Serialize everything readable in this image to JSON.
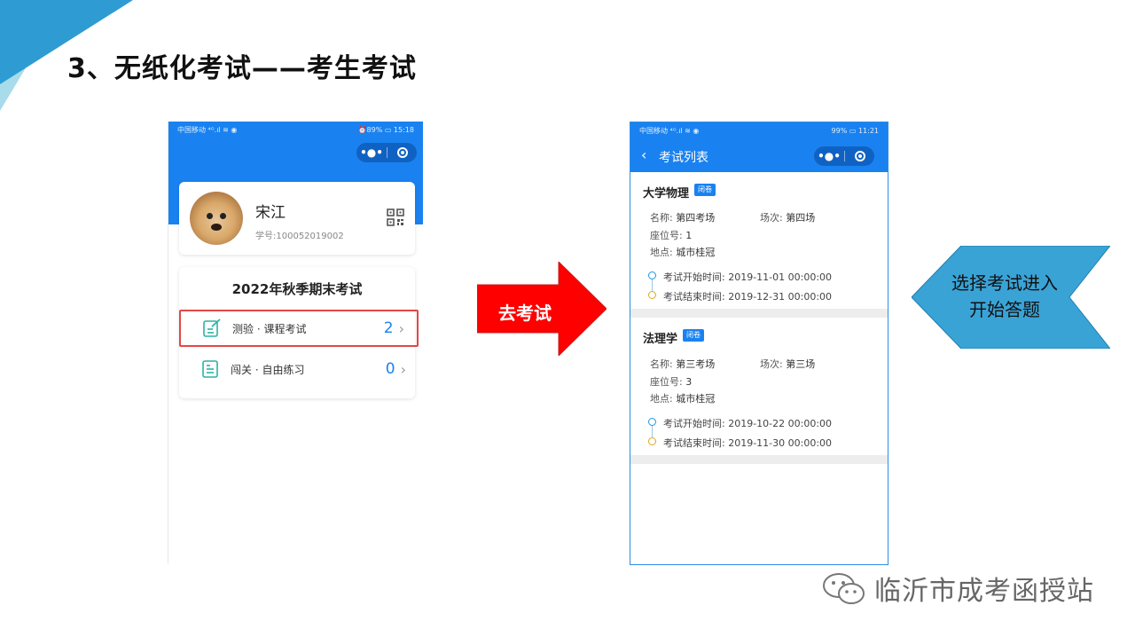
{
  "slide": {
    "title": "3、无纸化考试——考生考试"
  },
  "phone1": {
    "status_left": "中国移动 ⁴ᴳ.ıl ≋ ◉",
    "status_right": "⏰89% ▭ 15:18",
    "profile": {
      "name": "宋江",
      "student_id": "学号:100052019002"
    },
    "exam": {
      "title": "2022年秋季期末考试",
      "rows": [
        {
          "label": "测验 · 课程考试",
          "count": "2"
        },
        {
          "label": "闯关 · 自由练习",
          "count": "0"
        }
      ]
    }
  },
  "arrow": {
    "label": "去考试",
    "color": "#ff0000"
  },
  "phone2": {
    "status_left": "中国移动 ⁴ᴳ.ıl ≋ ◉",
    "status_right": "99% ▭ 11:21",
    "header_title": "考试列表",
    "exams": [
      {
        "name": "大学物理",
        "tag": "闭卷",
        "room_label": "名称:",
        "room": "第四考场",
        "session_label": "场次:",
        "session": "第四场",
        "seat_label": "座位号:",
        "seat": "1",
        "place_label": "地点:",
        "place": "城市桂冠",
        "start": "考试开始时间:  2019-11-01 00:00:00",
        "end": "考试结束时间:  2019-12-31 00:00:00"
      },
      {
        "name": "法理学",
        "tag": "闭卷",
        "room_label": "名称:",
        "room": "第三考场",
        "session_label": "场次:",
        "session": "第三场",
        "seat_label": "座位号:",
        "seat": "3",
        "place_label": "地点:",
        "place": "城市桂冠",
        "start": "考试开始时间:  2019-10-22 00:00:00",
        "end": "考试结束时间:  2019-11-30 00:00:00"
      }
    ]
  },
  "callout": {
    "text": "选择考试进入开始答题",
    "color": "#3aa3d6"
  },
  "watermark": {
    "text": "临沂市成考函授站"
  }
}
